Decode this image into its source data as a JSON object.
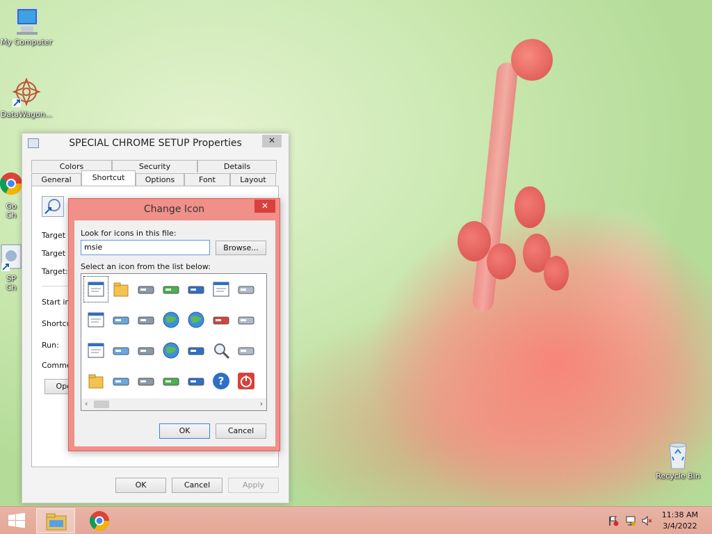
{
  "desktop": {
    "icons": [
      {
        "label": "My Computer"
      },
      {
        "label": "DataWagon..."
      },
      {
        "label": "Go\nCh"
      },
      {
        "label": "SP\nCh"
      },
      {
        "label": "Recycle Bin"
      }
    ]
  },
  "properties_dialog": {
    "title": "SPECIAL CHROME SETUP Properties",
    "close_glyph": "✕",
    "tabs_row1": [
      "Colors",
      "Security",
      "Details"
    ],
    "tabs_row2": [
      "General",
      "Shortcut",
      "Options",
      "Font",
      "Layout"
    ],
    "active_tab": "Shortcut",
    "fields": [
      "Target ty",
      "Target lo",
      "Target:",
      "Start in:",
      "Shortcut",
      "Run:",
      "Commen"
    ],
    "open_button": "Oper",
    "buttons": {
      "ok": "OK",
      "cancel": "Cancel",
      "apply": "Apply"
    }
  },
  "change_icon_dialog": {
    "title": "Change Icon",
    "close_glyph": "✕",
    "file_label": "Look for icons in this file:",
    "file_value": "msie",
    "browse_button": "Browse...",
    "list_label": "Select an icon from the list below:",
    "icons": [
      "window-text-icon",
      "folder-icon",
      "drive-icon",
      "memory-chip-icon",
      "printer-icon",
      "clock-document-icon",
      "monitor-card-icon",
      "document-icon",
      "network-drive-icon",
      "network-drive-2-icon",
      "internet-explorer-icon",
      "globe-monitor-icon",
      "control-panel-icon",
      "cube-icon",
      "window-icon",
      "floppy-drive-icon",
      "disconnected-drive-icon",
      "globe-clock-icon",
      "network-users-icon",
      "magnifier-icon",
      "drive-arrow-icon",
      "folder-open-icon",
      "hard-drive-icon",
      "cd-drive-icon",
      "computer-icon",
      "grid-icon",
      "help-icon",
      "shutdown-icon"
    ],
    "buttons": {
      "ok": "OK",
      "cancel": "Cancel"
    }
  },
  "taskbar": {
    "time": "11:38 AM",
    "date": "3/4/2022"
  }
}
